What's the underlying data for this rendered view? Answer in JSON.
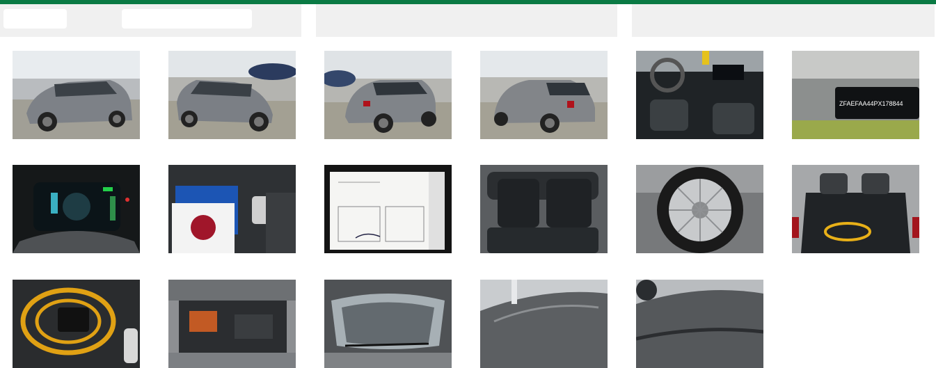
{
  "theme": {
    "accent": "#0a7a44",
    "header_bg": "#f0f0f0"
  },
  "filters": {
    "filter_1": "",
    "filter_2": ""
  },
  "gallery": {
    "photos": [
      {
        "name": "photo-front-left-exterior"
      },
      {
        "name": "photo-front-right-exterior"
      },
      {
        "name": "photo-rear-left-exterior"
      },
      {
        "name": "photo-rear-right-exterior"
      },
      {
        "name": "photo-dashboard-interior"
      },
      {
        "name": "photo-vin-plate",
        "text": "ZFAEFAA44PX178844"
      },
      {
        "name": "photo-instrument-cluster"
      },
      {
        "name": "photo-keys-and-manual"
      },
      {
        "name": "photo-service-document"
      },
      {
        "name": "photo-rear-seats"
      },
      {
        "name": "photo-wheel"
      },
      {
        "name": "photo-trunk"
      },
      {
        "name": "photo-charging-cable"
      },
      {
        "name": "photo-engine-bay"
      },
      {
        "name": "photo-windshield"
      },
      {
        "name": "photo-roof-front"
      },
      {
        "name": "photo-roof-rear"
      }
    ]
  }
}
